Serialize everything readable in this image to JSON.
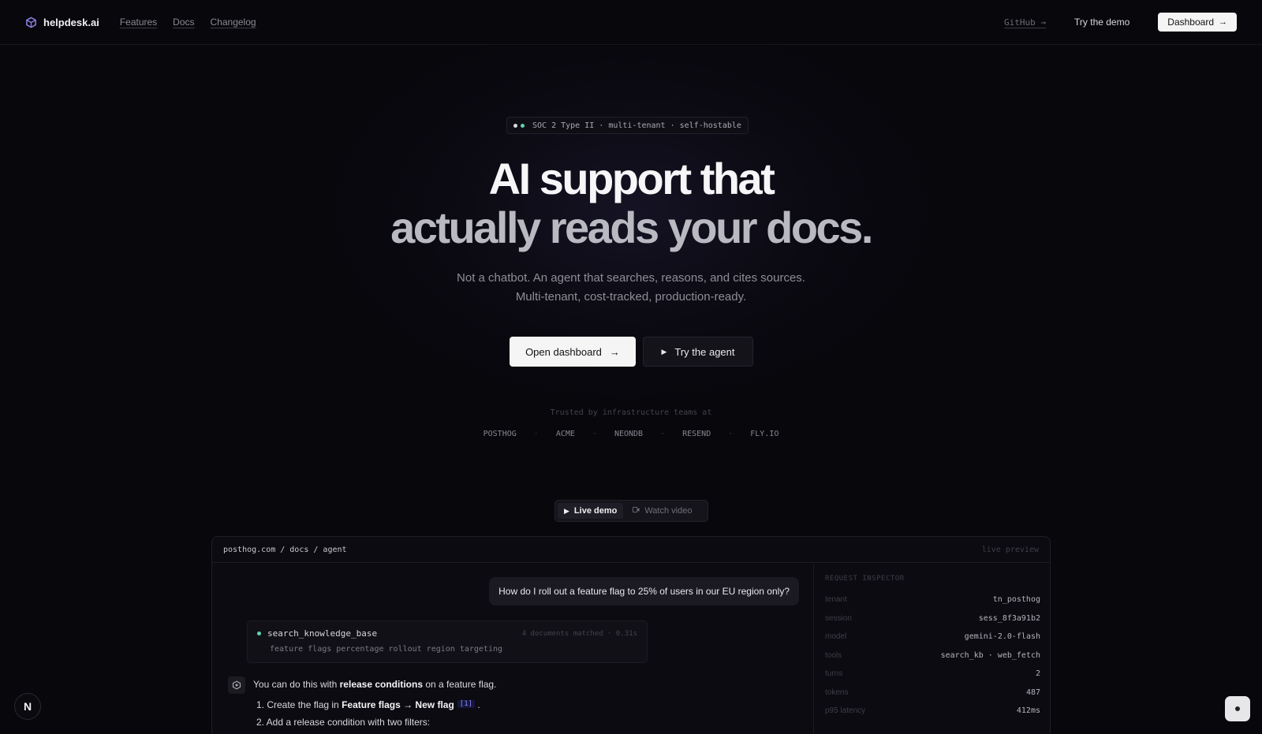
{
  "nav": {
    "brand": "helpdesk.ai",
    "brand_icon": "cube-icon",
    "links": [
      "Features",
      "Docs",
      "Changelog"
    ],
    "github": "GitHub →",
    "try_demo": "Try the demo",
    "dashboard": "Dashboard",
    "dashboard_arrow": "→"
  },
  "hero": {
    "badge": "SOC 2 Type II · multi-tenant · self-hostable",
    "badge_dot_colors": [
      "#d9d9df",
      "#5fd4b0"
    ],
    "title_line1": "AI support that",
    "title_line2": "actually reads your docs.",
    "subtitle_line1": "Not a chatbot. An agent that searches, reasons, and cites sources.",
    "subtitle_line2": "Multi-tenant, cost-tracked, production-ready.",
    "cta_primary": "Open dashboard",
    "cta_primary_arrow": "→",
    "cta_secondary": "Try the agent",
    "trusted_label": "Trusted by infrastructure teams at",
    "logos": [
      "POSTHOG",
      "ACME",
      "NEONDB",
      "RESEND",
      "FLY.IO"
    ],
    "logo_separator": "·"
  },
  "demo_toggle": {
    "live": "Live demo",
    "video": "Watch video"
  },
  "panel": {
    "breadcrumb": "posthog.com / docs / agent",
    "live_preview": "live preview",
    "user_message": "How do I roll out a feature flag to 25% of users in our EU region only?",
    "tool": {
      "name": "search_knowledge_base",
      "meta": "4 documents matched · 0.31s",
      "query": "feature flags percentage rollout region targeting"
    },
    "answer": {
      "pre": "You can do this with ",
      "bold": "release conditions",
      "post": " on a feature flag.",
      "step1_pre": "1. Create the flag in ",
      "step1_bold": "Feature flags → New flag",
      "step1_cite": "[1]",
      "step1_post": ".",
      "step2": "2. Add a release condition with two filters:"
    },
    "inspector": {
      "title": "REQUEST INSPECTOR",
      "rows": [
        {
          "k": "tenant",
          "v": "tn_posthog"
        },
        {
          "k": "session",
          "v": "sess_8f3a91b2"
        },
        {
          "k": "model",
          "v": "gemini-2.0-flash"
        },
        {
          "k": "tools",
          "v": "search_kb · web_fetch"
        },
        {
          "k": "turns",
          "v": "2"
        },
        {
          "k": "tokens",
          "v": "487"
        },
        {
          "k": "p95 latency",
          "v": "412ms"
        }
      ]
    }
  },
  "corner_badge": "N",
  "colors": {
    "background": "#08070c",
    "accent_green": "#5fd4b0",
    "cite": "#8b8cff"
  }
}
